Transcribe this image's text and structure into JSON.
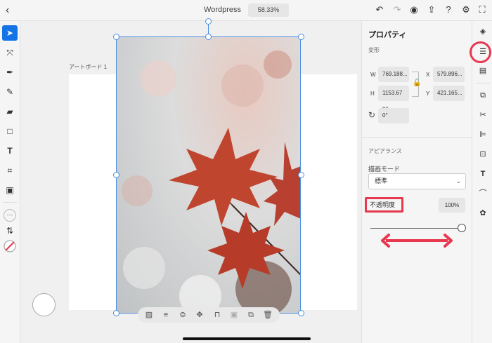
{
  "topbar": {
    "back_icon": "chevron-left-icon",
    "title": "Wordpress",
    "zoom": "58.33%",
    "icons": [
      "undo-icon",
      "redo-icon",
      "share-user-icon",
      "export-icon",
      "help-icon",
      "settings-gear-icon",
      "fullscreen-icon"
    ]
  },
  "left_tools": [
    "select-arrow-icon",
    "direct-select-icon",
    "pen-icon",
    "brush-icon",
    "eraser-icon",
    "rectangle-icon",
    "text-icon",
    "crop-icon",
    "image-icon",
    "more-icon",
    "swap-colors-icon",
    "stroke-color-icon"
  ],
  "canvas": {
    "artboard_label": "アートボード 1"
  },
  "object_toolbar": [
    "transparency-icon",
    "align-icon",
    "layers-icon",
    "move-icon",
    "lock-icon",
    "mask-icon",
    "duplicate-icon",
    "delete-icon"
  ],
  "properties": {
    "title": "プロパティ",
    "transform_label": "変形",
    "w_label": "W",
    "w_value": "769.188...",
    "x_label": "X",
    "x_value": "579.896...",
    "h_label": "H",
    "h_value": "1153.67 px",
    "y_label": "Y",
    "y_value": "421.165...",
    "rotation_value": "0°",
    "appearance_label": "アピアランス",
    "blend_mode_label": "描画モード",
    "blend_mode_value": "標準",
    "opacity_label": "不透明度",
    "opacity_value": "100%",
    "opacity_fraction": 1.0
  },
  "right_rail": [
    "layers-icon",
    "properties-icon",
    "pages-icon",
    "arrange-icon",
    "scissors-icon",
    "align-icon",
    "export-icon",
    "type-icon",
    "path-icon",
    "settings-icon"
  ],
  "colors": {
    "accent": "#1473e6",
    "annotation": "#e8384f",
    "selection": "#4a90e2"
  }
}
